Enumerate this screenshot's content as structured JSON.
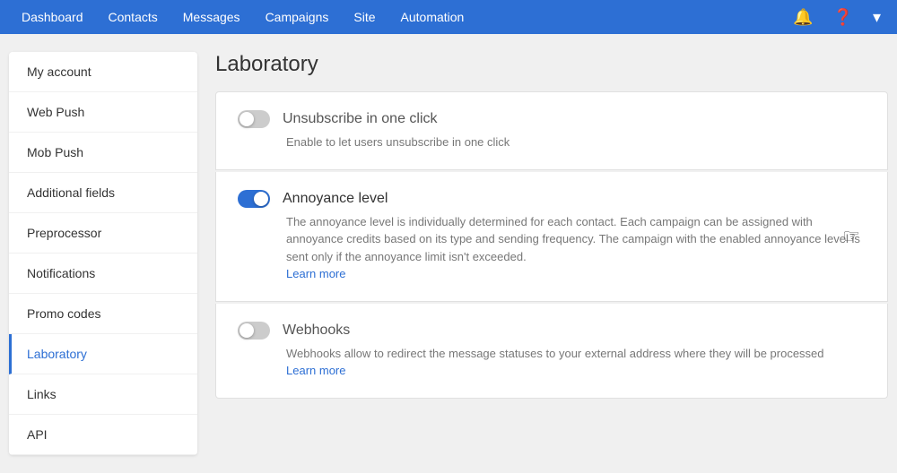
{
  "nav": {
    "items": [
      {
        "label": "Dashboard",
        "href": "#"
      },
      {
        "label": "Contacts",
        "href": "#"
      },
      {
        "label": "Messages",
        "href": "#"
      },
      {
        "label": "Campaigns",
        "href": "#"
      },
      {
        "label": "Site",
        "href": "#"
      },
      {
        "label": "Automation",
        "href": "#"
      }
    ]
  },
  "sidebar": {
    "items": [
      {
        "label": "My account",
        "id": "my-account",
        "active": false
      },
      {
        "label": "Web Push",
        "id": "web-push",
        "active": false
      },
      {
        "label": "Mob Push",
        "id": "mob-push",
        "active": false
      },
      {
        "label": "Additional fields",
        "id": "additional-fields",
        "active": false
      },
      {
        "label": "Preprocessor",
        "id": "preprocessor",
        "active": false
      },
      {
        "label": "Notifications",
        "id": "notifications",
        "active": false
      },
      {
        "label": "Promo codes",
        "id": "promo-codes",
        "active": false
      },
      {
        "label": "Laboratory",
        "id": "laboratory",
        "active": true
      },
      {
        "label": "Links",
        "id": "links",
        "active": false
      },
      {
        "label": "API",
        "id": "api",
        "active": false
      }
    ]
  },
  "page": {
    "title": "Laboratory"
  },
  "settings": [
    {
      "id": "unsubscribe",
      "title": "Unsubscribe in one click",
      "description": "Enable to let users unsubscribe in one click",
      "learn_more": null,
      "enabled": false
    },
    {
      "id": "annoyance",
      "title": "Annoyance level",
      "description": "The annoyance level is individually determined for each contact. Each campaign can be assigned with annoyance credits based on its type and sending frequency. The campaign with the enabled annoyance level is sent only if the annoyance limit isn't exceeded.",
      "learn_more": "Learn more",
      "enabled": true
    },
    {
      "id": "webhooks",
      "title": "Webhooks",
      "description": "Webhooks allow to redirect the message statuses to your external address where they will be processed",
      "learn_more": "Learn more",
      "enabled": false
    }
  ]
}
